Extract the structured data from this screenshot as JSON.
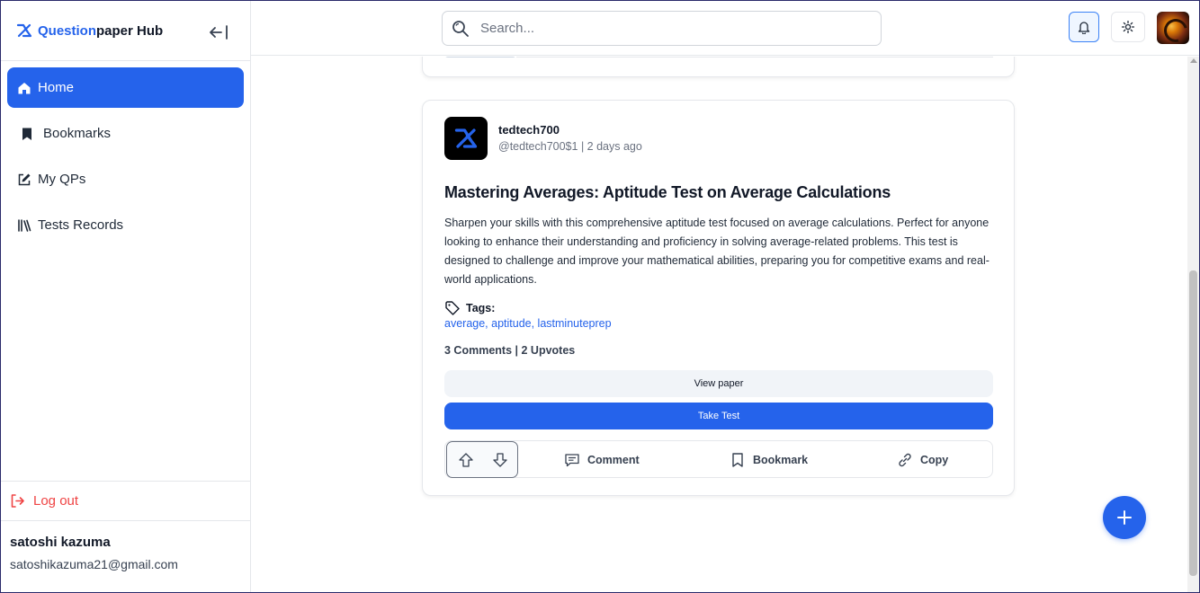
{
  "brand": {
    "name_highlight": "Question",
    "name_rest": "paper Hub"
  },
  "sidebar": {
    "items": [
      {
        "label": "Home",
        "icon": "home-icon",
        "active": true
      },
      {
        "label": "Bookmarks",
        "icon": "bookmark-icon",
        "active": false
      },
      {
        "label": "My QPs",
        "icon": "edit-icon",
        "active": false
      },
      {
        "label": "Tests Records",
        "icon": "library-icon",
        "active": false
      }
    ],
    "logout_label": "Log out",
    "user": {
      "name": "satoshi kazuma",
      "email": "satoshikazuma21@gmail.com"
    }
  },
  "header": {
    "search_placeholder": "Search...",
    "icons": [
      "bell-icon",
      "sun-icon"
    ]
  },
  "post": {
    "author": "tedtech700",
    "handle": "@tedtech700$1",
    "time": "2 days ago",
    "title": "Mastering Averages: Aptitude Test on Average Calculations",
    "description": "Sharpen your skills with this comprehensive aptitude test focused on average calculations. Perfect for anyone looking to enhance their understanding and proficiency in solving average-related problems. This test is designed to challenge and improve your mathematical abilities, preparing you for competitive exams and real-world applications.",
    "tags_label": "Tags:",
    "tags": "average, aptitude, lastminuteprep",
    "comments": "3 Comments",
    "separator": "|",
    "upvotes": "2 Upvotes",
    "view_label": "View paper",
    "test_label": "Take Test",
    "actions": {
      "comment": "Comment",
      "bookmark": "Bookmark",
      "copy": "Copy"
    }
  },
  "colors": {
    "accent": "#2563eb",
    "danger": "#ef4444",
    "text": "#111827",
    "muted": "#6b7280"
  }
}
